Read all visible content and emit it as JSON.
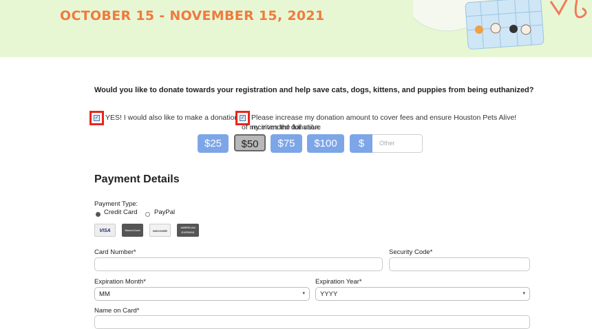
{
  "banner": {
    "title": "OCTOBER 15 - NOVEMBER 15, 2021"
  },
  "donation": {
    "question": "Would you like to donate towards your registration and help save cats, dogs, kittens, and puppies from being euthanized?",
    "option1": "YES! I would also like to make a donation",
    "option2_line1": "Please increase my donation amount to cover fees and ensure Houston Pets Alive! receives the full value",
    "option2_line2": "of my intended donation.",
    "amounts": [
      "$25",
      "$50",
      "$75",
      "$100"
    ],
    "selected": "$50",
    "custom_prefix": "$",
    "custom_placeholder": "Other"
  },
  "payment": {
    "title": "Payment Details",
    "type_label": "Payment Type:",
    "methods": [
      "Credit Card",
      "PayPal"
    ],
    "selected_method": "Credit Card",
    "card_brands": [
      "VISA",
      "MasterCard",
      "DISCOVER",
      "AMERICAN EXPRESS"
    ],
    "card_number_label": "Card Number*",
    "security_code_label": "Security Code*",
    "exp_month_label": "Expiration Month*",
    "exp_month_value": "MM",
    "exp_year_label": "Expiration Year*",
    "exp_year_value": "YYYY",
    "name_label": "Name on Card*"
  },
  "colors": {
    "accent_orange": "#f07a3d",
    "button_blue": "#7da6e8",
    "highlight_red": "#e8261a",
    "banner_green": "#e7f7d4"
  }
}
